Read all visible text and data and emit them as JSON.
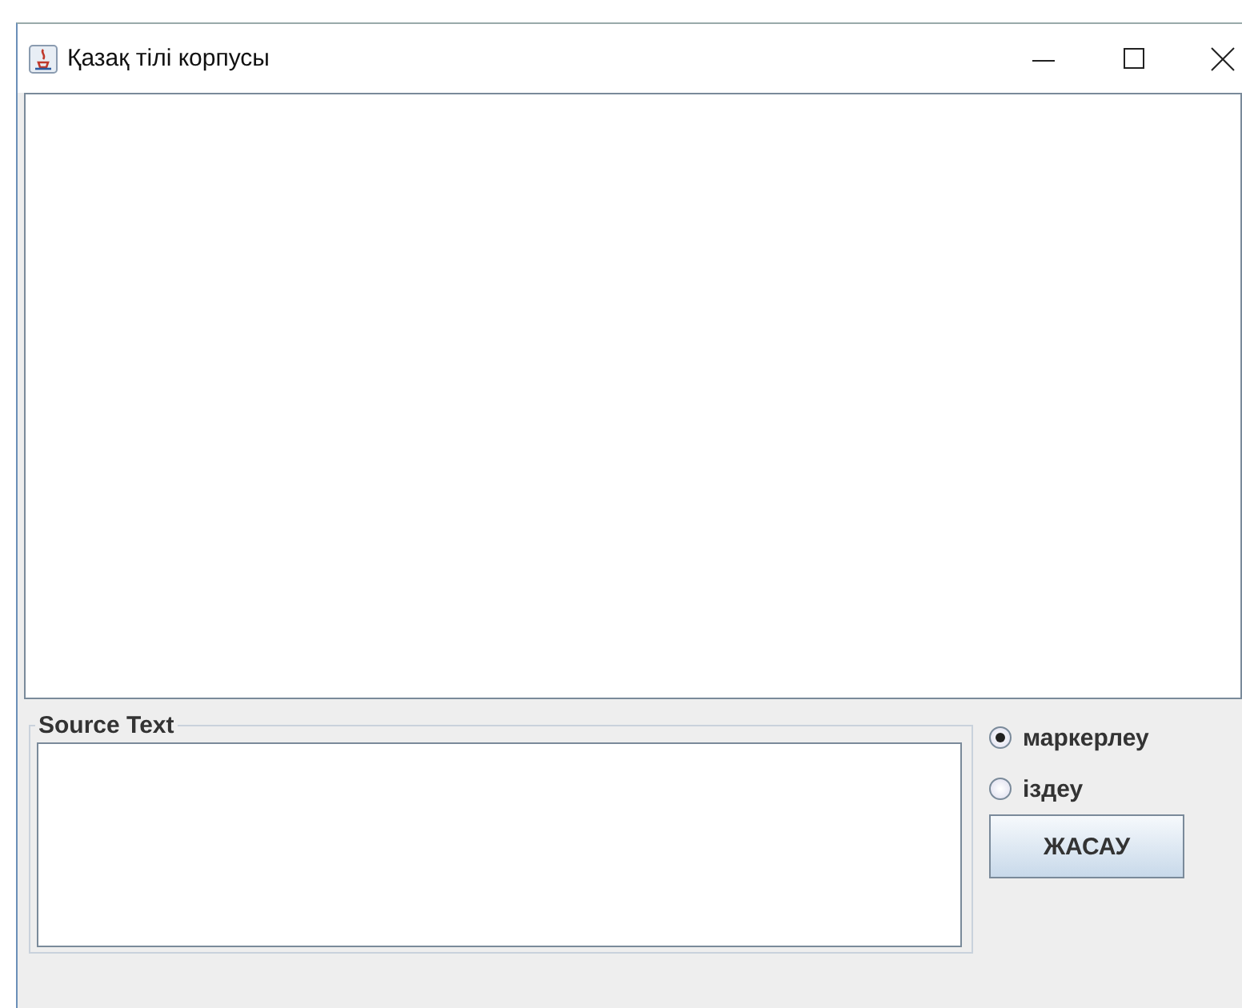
{
  "window": {
    "title": "Қазақ тілі корпусы"
  },
  "source_text": {
    "title": "Source Text"
  },
  "modes": [
    {
      "label": "маркерлеу",
      "selected": true
    },
    {
      "label": "іздеу",
      "selected": false
    }
  ],
  "action_button": {
    "label": "ЖАСАУ"
  }
}
